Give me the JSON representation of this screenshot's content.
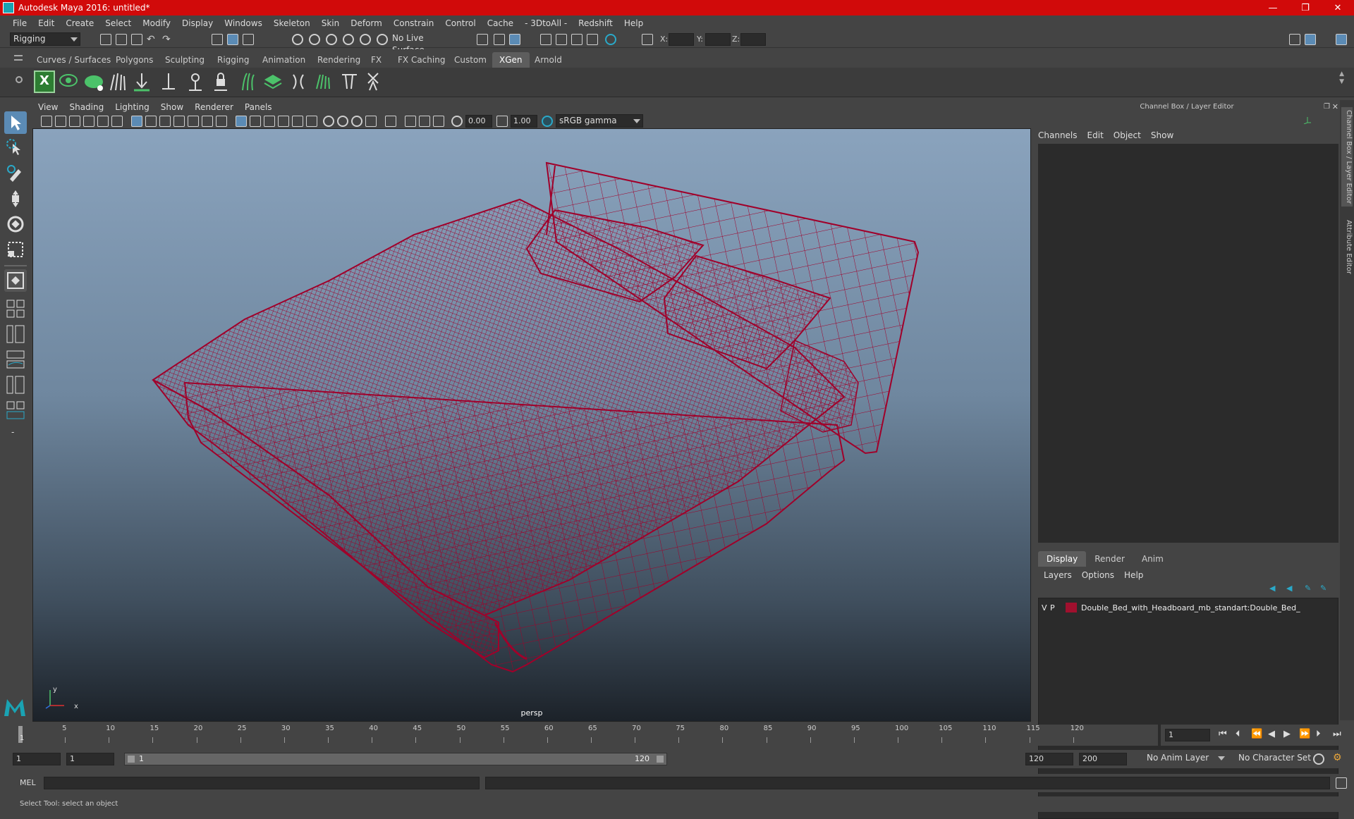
{
  "window": {
    "title": "Autodesk Maya 2016: untitled*",
    "minimize": "—",
    "restore": "❐",
    "close": "✕"
  },
  "menu": [
    "File",
    "Edit",
    "Create",
    "Select",
    "Modify",
    "Display",
    "Windows",
    "Skeleton",
    "Skin",
    "Deform",
    "Constrain",
    "Control",
    "Cache",
    "- 3DtoAll -",
    "Redshift",
    "Help"
  ],
  "status_line": {
    "menu_set": "Rigging",
    "live_surface": "No Live Surface",
    "x_label": "X:",
    "y_label": "Y:",
    "z_label": "Z:"
  },
  "shelf_tabs": [
    "Curves / Surfaces",
    "Polygons",
    "Sculpting",
    "Rigging",
    "Animation",
    "Rendering",
    "FX",
    "FX Caching",
    "Custom",
    "XGen",
    "Arnold"
  ],
  "active_shelf_tab": "XGen",
  "viewport": {
    "menu": [
      "View",
      "Shading",
      "Lighting",
      "Show",
      "Renderer",
      "Panels"
    ],
    "exposure": "0.00",
    "gamma": "1.00",
    "color_space": "sRGB gamma",
    "camera_label": "persp",
    "axis_y": "y",
    "axis_x": "x"
  },
  "channel_box": {
    "title": "Channel Box / Layer Editor",
    "menu": [
      "Channels",
      "Edit",
      "Object",
      "Show"
    ]
  },
  "layer_editor": {
    "tabs": [
      "Display",
      "Render",
      "Anim"
    ],
    "active_tab": "Display",
    "menu": [
      "Layers",
      "Options",
      "Help"
    ],
    "layers": [
      {
        "visible": "V",
        "playback": "P",
        "color": "#a0102e",
        "name": "Double_Bed_with_Headboard_mb_standart:Double_Bed_"
      }
    ]
  },
  "side_tabs": [
    "Channel Box / Layer Editor",
    "Attribute Editor"
  ],
  "timeline": {
    "ticks": [
      "5",
      "10",
      "15",
      "20",
      "25",
      "30",
      "35",
      "40",
      "45",
      "50",
      "55",
      "60",
      "65",
      "70",
      "75",
      "80",
      "85",
      "90",
      "95",
      "100",
      "105",
      "110",
      "115",
      "120"
    ],
    "current_frame_marker": "1",
    "current_frame": "1"
  },
  "range": {
    "start": "1",
    "playback_start": "1",
    "slider_start": "1",
    "slider_end": "120",
    "playback_end": "120",
    "end": "200",
    "anim_layer": "No Anim Layer",
    "character_set": "No Character Set"
  },
  "command_line": {
    "language": "MEL"
  },
  "help_line": "Select Tool: select an object",
  "colors": {
    "title_bar": "#d10a0a",
    "wireframe": "#a0002a",
    "active_tool": "#5b8bb5"
  }
}
